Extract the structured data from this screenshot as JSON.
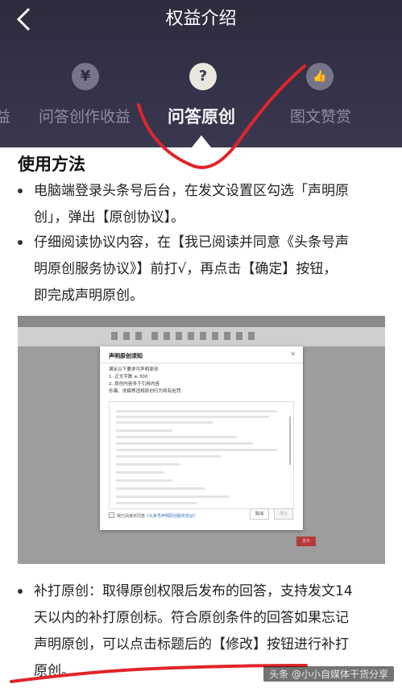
{
  "header": {
    "title": "权益介绍",
    "tabs": [
      {
        "label": "益",
        "icon": "partial-icon"
      },
      {
        "label": "问答创作收益",
        "icon": "yen-icon",
        "glyph": "¥"
      },
      {
        "label": "问答原创",
        "icon": "question-icon",
        "glyph": "?",
        "active": true
      },
      {
        "label": "图文赞赏",
        "icon": "thumb-up-icon",
        "glyph": "👍"
      }
    ]
  },
  "content": {
    "heading": "使用方法",
    "bullets": [
      [
        "电脑端登录头条号后台，在发文设置区勾选「声明原",
        "创」，弹出【原创协议】。"
      ],
      [
        "仔细阅读协议内容，在【我已阅读并同意《头条号声",
        "明原创服务协议》】前打√，再点击【确定】按钮，",
        "即完成声明原创。"
      ],
      [
        "补打原创：取得原创权限后发布的回答，支持发文14",
        "天以内的补打原创标。符合原创条件的回答如果忘记",
        "声明原创，可以点击标题后的【修改】按钮进行补打",
        "原创。"
      ]
    ]
  },
  "screenshot": {
    "dialog_title": "声明原创须知",
    "req_lines": [
      "满足以下要求可声明原创",
      "1. 正文字数 ≥ 300",
      "2. 原创内容多于引用内容",
      "抄袭、洗稿等违规原创行为将有处罚"
    ],
    "agree_prefix": "我已阅读并同意",
    "agree_link": "《头条号声明原创服务协议》",
    "cancel": "取消",
    "confirm": "确定",
    "publish": "发布"
  },
  "watermark": "头条 @小小自媒体干货分享",
  "colors": {
    "header_bg": "#2d2b3d",
    "accent_ink": "#e0252a"
  }
}
